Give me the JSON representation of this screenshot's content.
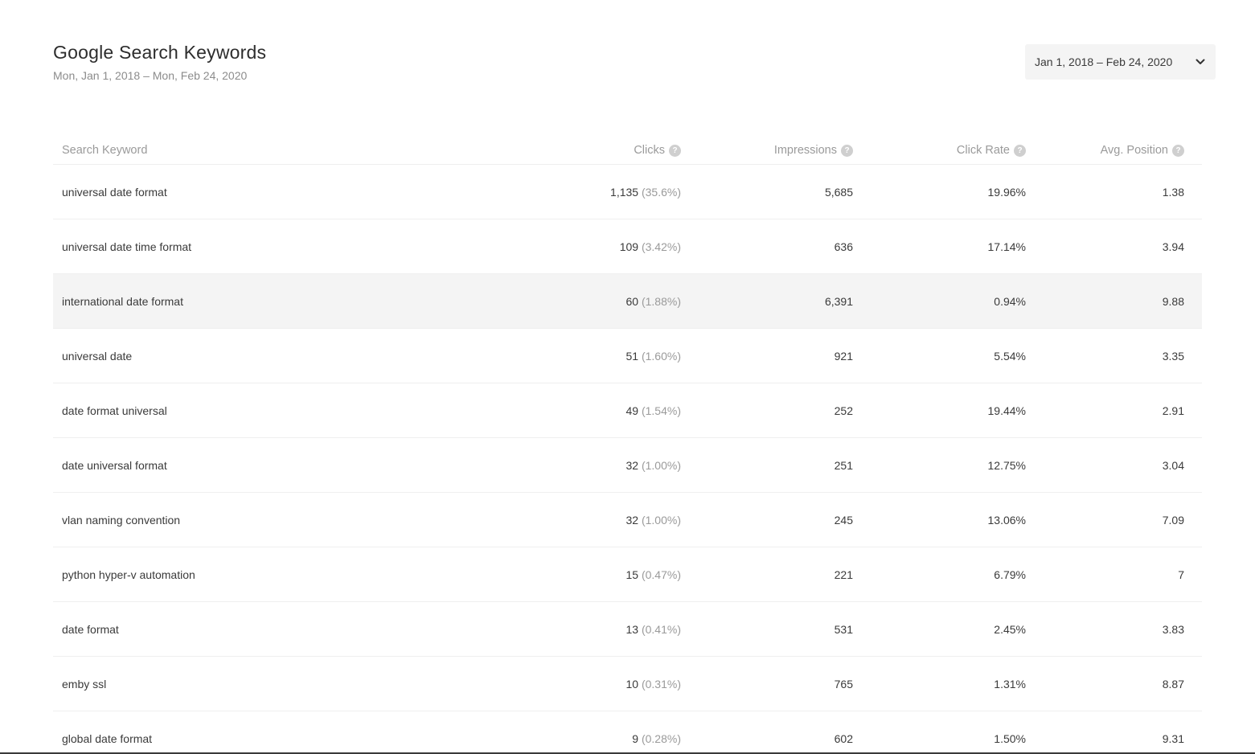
{
  "header": {
    "title": "Google Search Keywords",
    "subtitle": "Mon, Jan 1, 2018 – Mon, Feb 24, 2020",
    "date_range_selected": "Jan 1, 2018 – Feb 24, 2020"
  },
  "table": {
    "columns": {
      "keyword": "Search Keyword",
      "clicks": "Clicks",
      "impressions": "Impressions",
      "click_rate": "Click Rate",
      "avg_position": "Avg. Position"
    },
    "help_glyph": "?",
    "rows": [
      {
        "keyword": "universal date format",
        "clicks": "1,135",
        "clicks_pct": "(35.6%)",
        "impressions": "5,685",
        "click_rate": "19.96%",
        "avg_position": "1.38"
      },
      {
        "keyword": "universal date time format",
        "clicks": "109",
        "clicks_pct": "(3.42%)",
        "impressions": "636",
        "click_rate": "17.14%",
        "avg_position": "3.94"
      },
      {
        "keyword": "international date format",
        "clicks": "60",
        "clicks_pct": "(1.88%)",
        "impressions": "6,391",
        "click_rate": "0.94%",
        "avg_position": "9.88"
      },
      {
        "keyword": "universal date",
        "clicks": "51",
        "clicks_pct": "(1.60%)",
        "impressions": "921",
        "click_rate": "5.54%",
        "avg_position": "3.35"
      },
      {
        "keyword": "date format universal",
        "clicks": "49",
        "clicks_pct": "(1.54%)",
        "impressions": "252",
        "click_rate": "19.44%",
        "avg_position": "2.91"
      },
      {
        "keyword": "date universal format",
        "clicks": "32",
        "clicks_pct": "(1.00%)",
        "impressions": "251",
        "click_rate": "12.75%",
        "avg_position": "3.04"
      },
      {
        "keyword": "vlan naming convention",
        "clicks": "32",
        "clicks_pct": "(1.00%)",
        "impressions": "245",
        "click_rate": "13.06%",
        "avg_position": "7.09"
      },
      {
        "keyword": "python hyper-v automation",
        "clicks": "15",
        "clicks_pct": "(0.47%)",
        "impressions": "221",
        "click_rate": "6.79%",
        "avg_position": "7"
      },
      {
        "keyword": "date format",
        "clicks": "13",
        "clicks_pct": "(0.41%)",
        "impressions": "531",
        "click_rate": "2.45%",
        "avg_position": "3.83"
      },
      {
        "keyword": "emby ssl",
        "clicks": "10",
        "clicks_pct": "(0.31%)",
        "impressions": "765",
        "click_rate": "1.31%",
        "avg_position": "8.87"
      },
      {
        "keyword": "global date format",
        "clicks": "9",
        "clicks_pct": "(0.28%)",
        "impressions": "602",
        "click_rate": "1.50%",
        "avg_position": "9.31"
      }
    ]
  },
  "icons": {
    "dropdown": "chevron-down-icon",
    "help": "help-circle-icon"
  },
  "colors": {
    "highlight_row": "#f4f4f4",
    "muted_text": "#9a9a9a",
    "help_badge": "#cfcfcf"
  }
}
